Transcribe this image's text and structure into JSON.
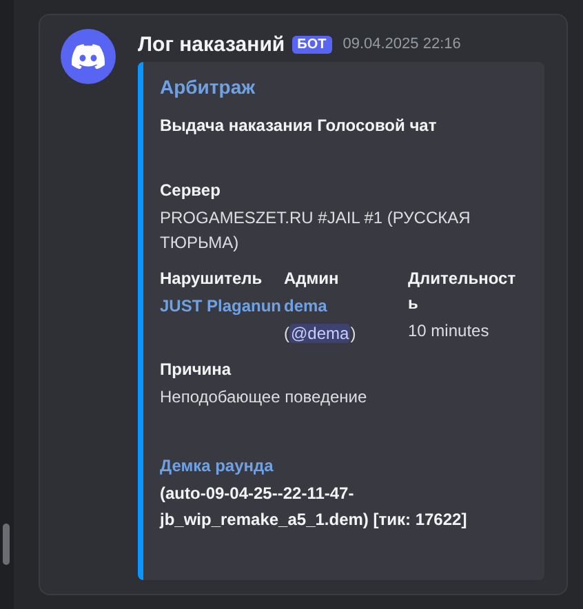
{
  "message": {
    "author": "Лог наказаний",
    "badge": "БОТ",
    "timestamp": "09.04.2025 22:16",
    "embed": {
      "title": "Арбитраж",
      "description": "Выдача наказания Голосовой чат",
      "fields": [
        {
          "name": "Сервер",
          "name_link": false,
          "inline": false,
          "bold": false,
          "lines": [
            [
              {
                "kind": "text",
                "text": "PROGAMESZET.RU #JAIL #1 (РУССКАЯ ТЮРЬМА)"
              }
            ]
          ]
        },
        {
          "name": "Нарушитель",
          "name_link": false,
          "inline": true,
          "bold": false,
          "lines": [
            [
              {
                "kind": "link",
                "text": "JUST Plaganun"
              }
            ]
          ]
        },
        {
          "name": "Админ",
          "name_link": false,
          "inline": true,
          "bold": false,
          "lines": [
            [
              {
                "kind": "link",
                "text": "dema"
              }
            ],
            [
              {
                "kind": "text",
                "text": "("
              },
              {
                "kind": "mention",
                "text": "@dema"
              },
              {
                "kind": "text",
                "text": ")"
              }
            ]
          ]
        },
        {
          "name": "Длительность",
          "name_link": false,
          "inline": true,
          "bold": false,
          "lines": [
            [
              {
                "kind": "text",
                "text": "10 minutes"
              }
            ]
          ]
        },
        {
          "name": "Причина",
          "name_link": false,
          "inline": false,
          "bold": false,
          "lines": [
            [
              {
                "kind": "text",
                "text": "Неподобающее поведение"
              }
            ]
          ]
        },
        {
          "name": "Демка раунда",
          "name_link": true,
          "inline": false,
          "bold": true,
          "lines": [
            [
              {
                "kind": "text",
                "text": "(auto-09-04-25--22-11-47-jb_wip_remake_a5_1.dem) [тик: 17622]"
              }
            ]
          ]
        }
      ]
    }
  }
}
